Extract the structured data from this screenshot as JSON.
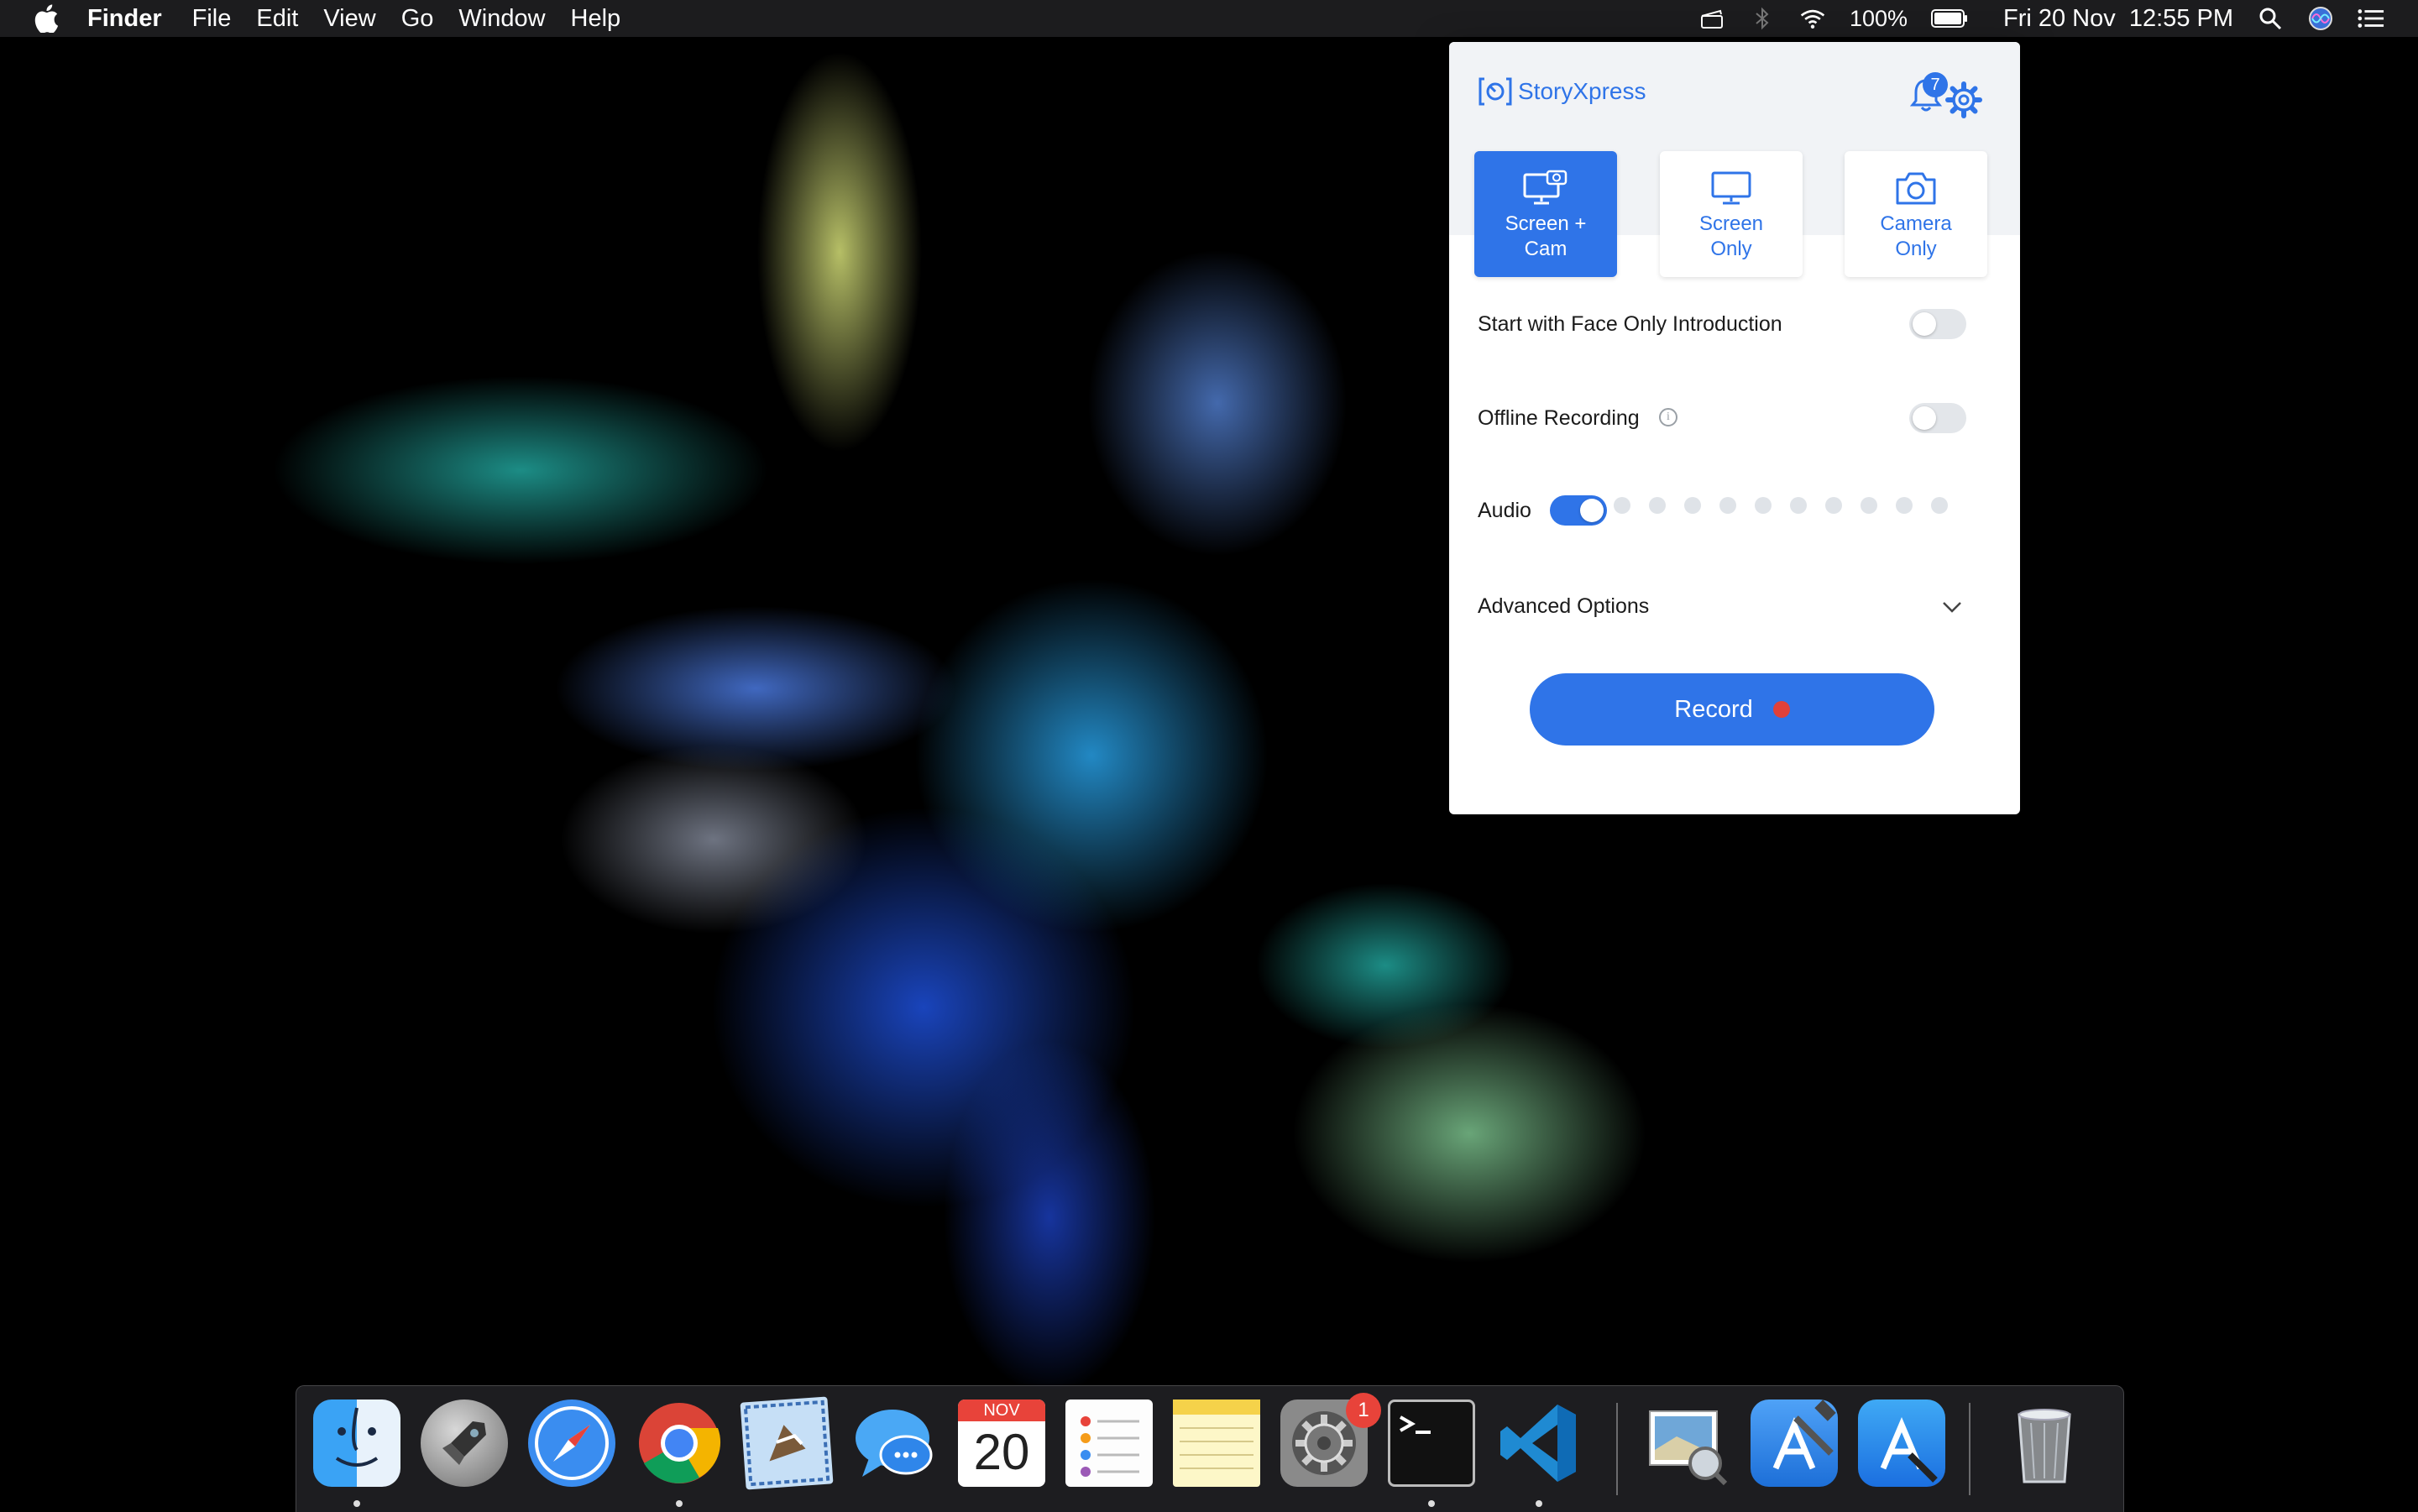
{
  "menubar": {
    "app_name": "Finder",
    "menus": [
      "File",
      "Edit",
      "View",
      "Go",
      "Window",
      "Help"
    ],
    "battery": "100%",
    "datetime": "Fri 20 Nov  12:55 PM"
  },
  "popup": {
    "brand": "StoryXpress",
    "notification_count": "7",
    "modes": [
      {
        "line1": "Screen +",
        "line2": "Cam"
      },
      {
        "line1": "Screen",
        "line2": "Only"
      },
      {
        "line1": "Camera",
        "line2": "Only"
      }
    ],
    "selected_mode": "Screen + Cam",
    "face_intro_label": "Start with Face Only Introduction",
    "face_intro_enabled": false,
    "offline_label": "Offline Recording",
    "offline_info_glyph": "i",
    "offline_enabled": false,
    "audio_label": "Audio",
    "audio_enabled": true,
    "audio_level_dots": 10,
    "advanced_label": "Advanced Options",
    "record_label": "Record"
  },
  "dock": {
    "calendar_month": "NOV",
    "calendar_day": "20",
    "system_prefs_badge": "1",
    "apps": [
      "Finder",
      "Launchpad",
      "Safari",
      "Chrome",
      "Mail",
      "Messages",
      "Calendar",
      "Reminders",
      "Notes",
      "System Preferences",
      "Terminal",
      "Visual Studio Code",
      "Preview",
      "Xcode",
      "App Store",
      "Trash"
    ]
  },
  "colors": {
    "accent": "#2f74e8",
    "record_dot": "#e0413a",
    "menubar": "#1c1c1e"
  }
}
